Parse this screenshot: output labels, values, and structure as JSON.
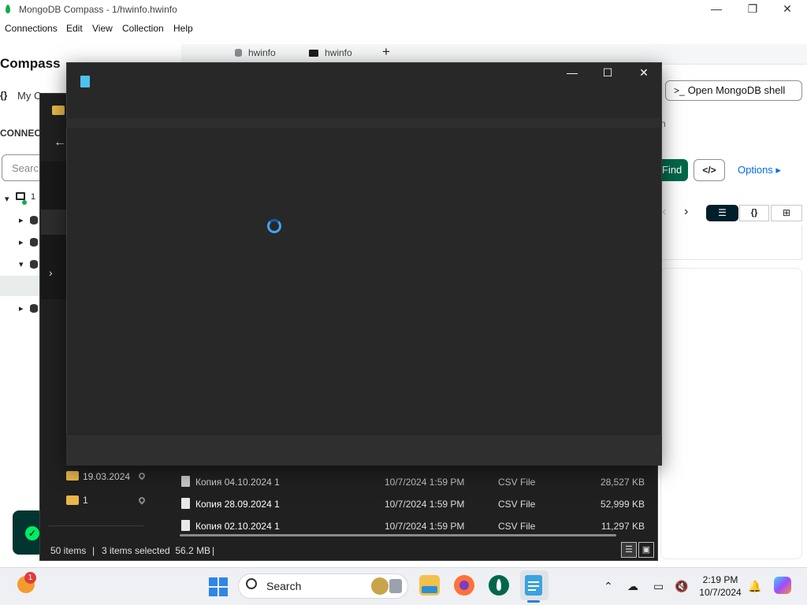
{
  "compass": {
    "title": "MongoDB Compass - 1/hwinfo.hwinfo",
    "menu": [
      "Connections",
      "Edit",
      "View",
      "Collection",
      "Help"
    ],
    "logo": "Compass",
    "my_connections": "My Co",
    "connections_header": "CONNEC",
    "search_placeholder": "Searc",
    "tree_first_label": "1",
    "tabs": [
      {
        "label": "hwinfo",
        "icon": "database-icon"
      },
      {
        "label": "hwinfo",
        "icon": "folder-icon"
      }
    ],
    "tab_add": "+",
    "open_shell": "Open MongoDB shell",
    "shell_prompt": ">_",
    "find": "Find",
    "code_toggle": "</>",
    "options": "Options ▸",
    "view_modes": {
      "list": "☰",
      "json": "{}",
      "table": "⊞"
    },
    "pager": {
      "prev": "‹",
      "next": "›"
    },
    "accent": "#00684a",
    "link_color": "#016bf8"
  },
  "explorer": {
    "nav_folders": [
      {
        "name": "19.03.2024",
        "pinned": true
      },
      {
        "name": "1",
        "pinned": true
      }
    ],
    "files": [
      {
        "name": "Копия 04.10.2024 1",
        "date": "10/7/2024 1:59 PM",
        "type": "CSV File",
        "size": "28,527 KB",
        "selected": false
      },
      {
        "name": "Копия 28.09.2024 1",
        "date": "10/7/2024 1:59 PM",
        "type": "CSV File",
        "size": "52,999 KB",
        "selected": true
      },
      {
        "name": "Копия 02.10.2024 1",
        "date": "10/7/2024 1:59 PM",
        "type": "CSV File",
        "size": "11,297 KB",
        "selected": true
      }
    ],
    "status_items": "50 items",
    "status_selected": "3 items selected  56.2 MB",
    "status_sep": "|"
  },
  "notepad": {
    "state": "loading",
    "spinner_color": "#3fa4ff",
    "controls": {
      "minimize": "—",
      "maximize": "☐",
      "close": "✕"
    }
  },
  "taskbar": {
    "search_label": "Search",
    "weather_badge": "1",
    "clock_time": "2:19 PM",
    "clock_date": "10/7/2024",
    "apps": [
      "file-explorer",
      "firefox",
      "mongodb-compass",
      "notepad"
    ],
    "tray": [
      "chevron-up-icon",
      "onedrive-icon",
      "display-icon",
      "volume-muted-icon",
      "notification-bell-icon",
      "copilot-icon"
    ]
  }
}
